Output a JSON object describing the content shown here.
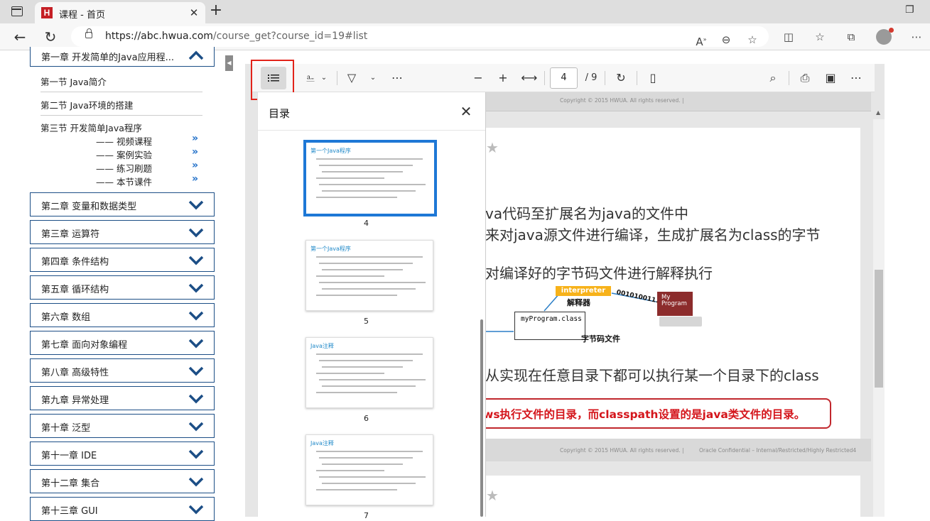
{
  "browser": {
    "tab_title": "课程 - 首页",
    "favicon_letter": "H",
    "url_host": "https://abc.hwua.com",
    "url_path": "/course_get?course_id=19#list"
  },
  "nav": {
    "first_chapter": "第一章 开发简单的Java应用程...",
    "sections": [
      "第一节 Java简介",
      "第二节 Java环境的搭建",
      "第三节 开发简单Java程序"
    ],
    "subitems": [
      "—— 视频课程",
      "—— 案例实验",
      "—— 练习刷题",
      "—— 本节课件"
    ],
    "sub_arrow": "»",
    "chapters": [
      "第二章 变量和数据类型",
      "第三章 运算符",
      "第四章 条件结构",
      "第五章 循环结构",
      "第六章 数组",
      "第七章 面向对象编程",
      "第八章 高级特性",
      "第九章 异常处理",
      "第十章 泛型",
      "第十一章 IDE",
      "第十二章 集合",
      "第十三章 GUI"
    ]
  },
  "pdf": {
    "page_current": "4",
    "page_total": "/ 9",
    "toc_title": "目录",
    "thumb_pages": [
      "4",
      "5",
      "6",
      "7"
    ],
    "thumb_headers": [
      "第一个Java程序",
      "第一个Java程序",
      "Java注释",
      "Java注释"
    ],
    "copyright_top": "Copyright © 2015 HWUA. All rights reserved.  |",
    "copyright_bottom": "Copyright © 2015 HWUA. All rights reserved.  |",
    "confidential": "Oracle Confidential – Internal/Restricted/Highly Restricted4",
    "slide_lines": [
      "va代码至扩展名为java的文件中",
      "来对java源文件进行编译，生成扩展名为class的字节",
      "对编译好的字节码文件进行解释执行",
      "从实现在任意目录下都可以执行某一个目录下的class"
    ],
    "warning": "ws执行文件的目录，而classpath设置的是java类文件的目录。",
    "diagram": {
      "interpreter": "interpreter",
      "interpreter_cn": "解释器",
      "bits": "001010011...",
      "program": "My Program",
      "bytecode_file": "myProgram.class",
      "bytecode_cn": "字节码文件"
    }
  },
  "colors": {
    "accent": "#1c4e86",
    "highlight": "#e2231a",
    "warning": "#d4151b",
    "active_thumb": "#1e78d6"
  }
}
